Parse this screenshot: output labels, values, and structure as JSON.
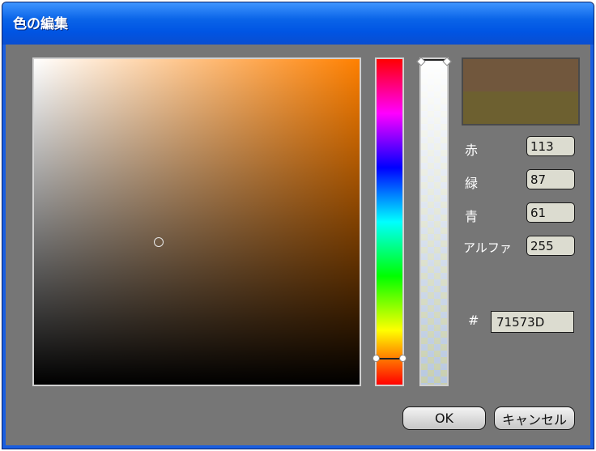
{
  "window": {
    "title": "色の編集"
  },
  "picker": {
    "hue_color": "#ff8000",
    "hue_position_fraction": 0.92,
    "alpha_position_fraction": 0.0,
    "saturation_fraction": 0.38,
    "value_fraction": 0.44
  },
  "preview": {
    "new_color": "#71573D",
    "old_color": "#6d6030"
  },
  "fields": {
    "red_label": "赤",
    "red_value": "113",
    "green_label": "緑",
    "green_value": "87",
    "blue_label": "青",
    "blue_value": "61",
    "alpha_label": "アルファ",
    "alpha_value": "255",
    "hex_label": "#",
    "hex_value": "71573D"
  },
  "buttons": {
    "ok_label": "OK",
    "cancel_label": "キャンセル"
  }
}
